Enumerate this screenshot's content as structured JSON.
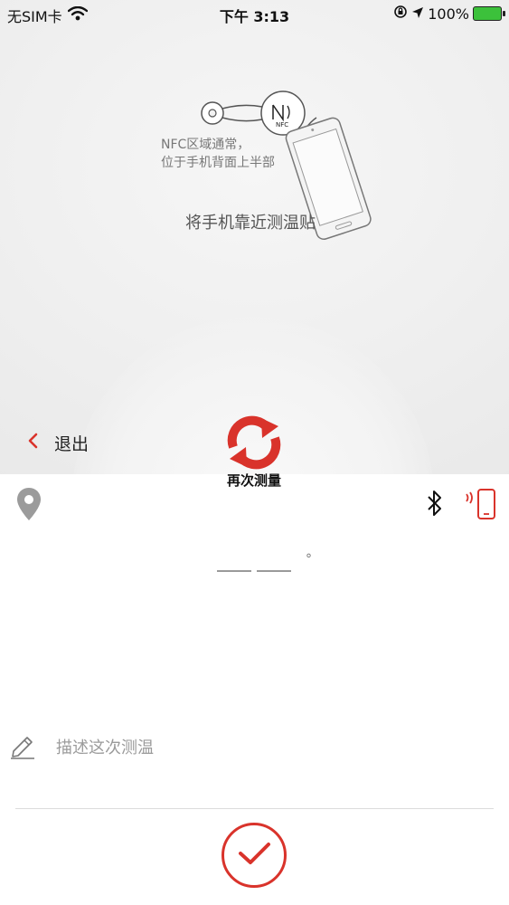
{
  "status_bar": {
    "carrier": "无SIM卡",
    "time": "下午 3:13",
    "battery": "100%"
  },
  "nfc_guide": {
    "hint_line1": "NFC区域通常，",
    "hint_line2": "位于手机背面上半部",
    "tag_label": "NFC",
    "prompt": "将手机靠近测温贴"
  },
  "toolbar": {
    "exit_label": "退出",
    "remeasure_label": "再次测量"
  },
  "reading": {
    "unit": "°"
  },
  "description": {
    "placeholder": "描述这次测温"
  },
  "colors": {
    "accent": "#d9332b",
    "icon_gray": "#9b9b9b"
  }
}
